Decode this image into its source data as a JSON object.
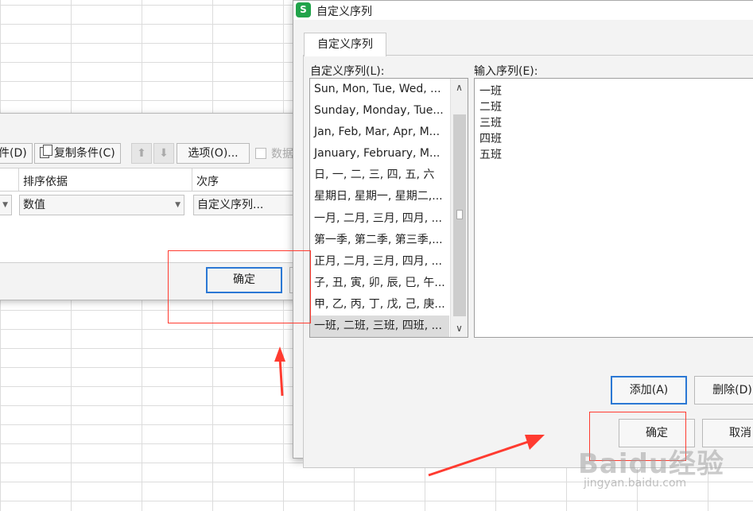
{
  "sort_dialog": {
    "toolbar": {
      "delete_condition": "件(D)",
      "copy_condition": "复制条件(C)",
      "move_up": "⬆",
      "move_down": "⬇",
      "options": "选项(O)...",
      "data_has_header": "数据"
    },
    "columns": {
      "sort_by": "排序依据",
      "order": "次序"
    },
    "row": {
      "sort_by_value": "数值",
      "order_value": "自定义序列..."
    },
    "ok_label": "确定"
  },
  "custom_list_dialog": {
    "title": "自定义序列",
    "app_icon_letter": "S",
    "tab_label": "自定义序列",
    "lists_label": "自定义序列(L):",
    "input_label": "输入序列(E):",
    "lists": [
      "Sun, Mon, Tue, Wed, ...",
      "Sunday, Monday, Tue...",
      "Jan, Feb, Mar, Apr, M...",
      "January, February, M...",
      "日, 一, 二, 三, 四, 五, 六",
      "星期日, 星期一, 星期二,...",
      "一月, 二月, 三月, 四月, ...",
      "第一季, 第二季, 第三季,...",
      "正月, 二月, 三月, 四月, ...",
      "子, 丑, 寅, 卯, 辰, 巳, 午...",
      "甲, 乙, 丙, 丁, 戊, 己, 庚...",
      "一班, 二班, 三班, 四班, ..."
    ],
    "selected_index": 11,
    "input_entries": [
      "一班",
      "二班",
      "三班",
      "四班",
      "五班"
    ],
    "add_button": "添加(A)",
    "delete_button": "删除(D)",
    "ok_button": "确定",
    "cancel_button": "取消"
  },
  "watermark": {
    "logo": "Baidu经验",
    "url": "jingyan.baidu.com"
  },
  "colors": {
    "annotation": "#ff3b30",
    "focus": "#2b78d4",
    "app_icon": "#21a34a"
  }
}
